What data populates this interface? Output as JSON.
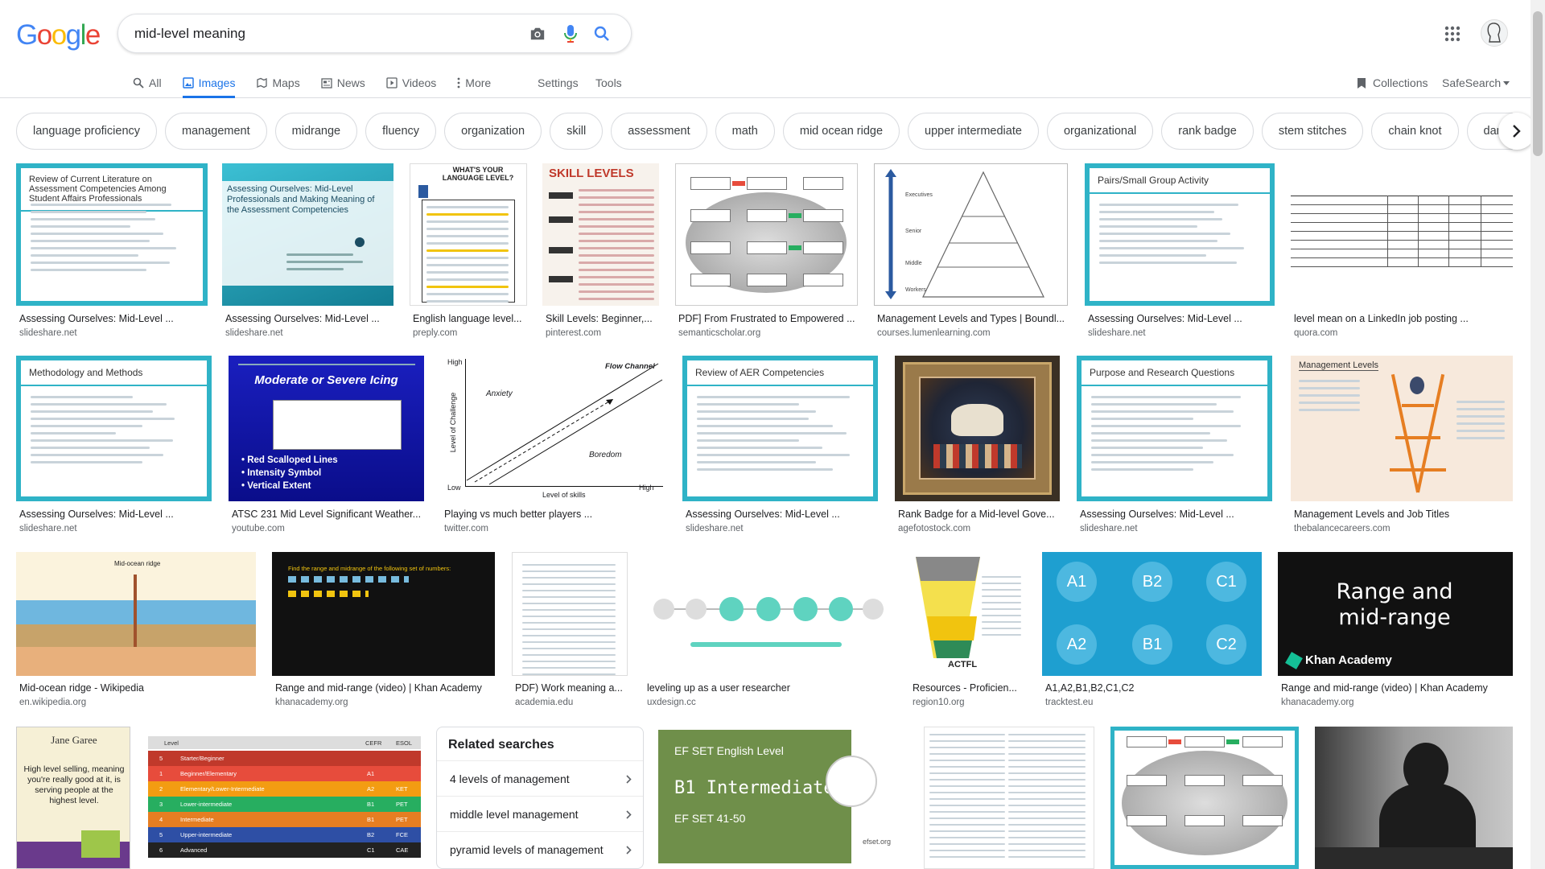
{
  "logo": {
    "g1": "G",
    "o1": "o",
    "o2": "o",
    "g2": "g",
    "l": "l",
    "e": "e"
  },
  "search": {
    "query": "mid-level meaning",
    "camera_icon": "camera-icon",
    "mic_icon": "microphone-icon",
    "search_icon": "search-icon"
  },
  "tabs": [
    {
      "label": "All",
      "icon": "search-icon"
    },
    {
      "label": "Images",
      "icon": "image-icon"
    },
    {
      "label": "Maps",
      "icon": "map-pin-icon"
    },
    {
      "label": "News",
      "icon": "news-icon"
    },
    {
      "label": "Videos",
      "icon": "play-icon"
    },
    {
      "label": "More",
      "icon": "kebab-icon"
    }
  ],
  "tools": {
    "settings": "Settings",
    "tools": "Tools",
    "collections": "Collections",
    "safesearch": "SafeSearch"
  },
  "chips": [
    "language proficiency",
    "management",
    "midrange",
    "fluency",
    "organization",
    "skill",
    "assessment",
    "math",
    "mid ocean ridge",
    "upper intermediate",
    "organizational",
    "rank badge",
    "stem stitches",
    "chain knot",
    "damask weave"
  ],
  "results": {
    "row1": [
      {
        "title": "Assessing Ourselves: Mid-Level ...",
        "source": "slideshare.net",
        "text": "Review of Current Literature on Assessment Competencies Among Student Affairs Professionals"
      },
      {
        "title": "Assessing Ourselves: Mid-Level ...",
        "source": "slideshare.net",
        "text": "Assessing Ourselves: Mid-Level Professionals and Making Meaning of the Assessment Competencies"
      },
      {
        "title": "English language level...",
        "source": "preply.com",
        "text": "WHAT'S YOUR LANGUAGE LEVEL?"
      },
      {
        "title": "Skill Levels: Beginner,...",
        "source": "pinterest.com",
        "text": "SKILL LEVELS"
      },
      {
        "title": "PDF] From Frustrated to Empowered ...",
        "source": "semanticscholar.org",
        "text": ""
      },
      {
        "title": "Management Levels and Types | Boundl...",
        "source": "courses.lumenlearning.com",
        "text": ""
      },
      {
        "title": "Assessing Ourselves: Mid-Level ...",
        "source": "slideshare.net",
        "text": "Pairs/Small Group Activity"
      },
      {
        "title": "level mean on a LinkedIn job posting ...",
        "source": "quora.com",
        "text": ""
      }
    ],
    "row2": [
      {
        "title": "Assessing Ourselves: Mid-Level ...",
        "source": "slideshare.net",
        "text": "Methodology and Methods"
      },
      {
        "title": "ATSC 231 Mid Level Significant Weather...",
        "source": "youtube.com",
        "text": "Moderate or Severe Icing",
        "bullets": [
          "• Red Scalloped Lines",
          "• Intensity Symbol",
          "• Vertical Extent"
        ]
      },
      {
        "title": "Playing vs much better players ...",
        "source": "twitter.com",
        "labels": {
          "high": "High",
          "low": "Low",
          "high2": "High",
          "flow": "Flow Channel",
          "anxiety": "Anxiety",
          "boredom": "Boredom",
          "ychal": "Level of Challenge",
          "xskill": "Level of skills"
        }
      },
      {
        "title": "Assessing Ourselves: Mid-Level ...",
        "source": "slideshare.net",
        "text": "Review of AER Competencies"
      },
      {
        "title": "Rank Badge for a Mid-level Gove...",
        "source": "agefotostock.com",
        "text": ""
      },
      {
        "title": "Assessing Ourselves: Mid-Level ...",
        "source": "slideshare.net",
        "text": "Purpose and Research Questions"
      },
      {
        "title": "Management Levels and Job Titles",
        "source": "thebalancecareers.com",
        "text": "Management Levels"
      }
    ],
    "row3": [
      {
        "title": "Mid-ocean ridge - Wikipedia",
        "source": "en.wikipedia.org",
        "text": "Mid-ocean ridge"
      },
      {
        "title": "Range and mid-range (video) | Khan Academy",
        "source": "khanacademy.org",
        "text": "Find the range and midrange of the following set of numbers:"
      },
      {
        "title": "PDF) Work meaning a...",
        "source": "academia.edu",
        "text": ""
      },
      {
        "title": "leveling up as a user researcher",
        "source": "uxdesign.cc",
        "text": ""
      },
      {
        "title": "Resources - Proficien...",
        "source": "region10.org",
        "text": "ACTFL"
      },
      {
        "title": "A1,A2,B1,B2,C1,C2",
        "source": "tracktest.eu",
        "levels": [
          "A1",
          "B2",
          "C1",
          "A2",
          "B1",
          "C2"
        ]
      },
      {
        "title": "Range and mid-range (video) | Khan Academy",
        "source": "khanacademy.org",
        "text": "Range and mid-range",
        "brand": "Khan Academy"
      }
    ],
    "row4": [
      {
        "text": "Jane Garee",
        "quote": "High level selling, meaning you're really good at it, is serving people at the highest level."
      },
      {
        "header": {
          "level": "Level",
          "cefr": "CEFR",
          "esol": "ESOL"
        },
        "rows": [
          [
            "5",
            "Starter/Beginner",
            "",
            ""
          ],
          [
            "1",
            "Beginner/Elementary",
            "A1",
            ""
          ],
          [
            "2",
            "Elementary/Lower-Intermediate",
            "A2",
            "KET"
          ],
          [
            "3",
            "Lower-intermediate",
            "B1",
            "PET"
          ],
          [
            "4",
            "Intermediate",
            "B1",
            "PET"
          ],
          [
            "5",
            "Upper-intermediate",
            "B2",
            "FCE"
          ],
          [
            "6",
            "Advanced",
            "C1",
            "CAE"
          ]
        ]
      },
      {
        "text": "EF SET English Level",
        "level": "B1 Intermediate",
        "score": "EF SET 41-50",
        "site": "efset.org"
      }
    ]
  },
  "related": {
    "title": "Related searches",
    "items": [
      "4 levels of management",
      "middle level management",
      "pyramid levels of management"
    ]
  }
}
